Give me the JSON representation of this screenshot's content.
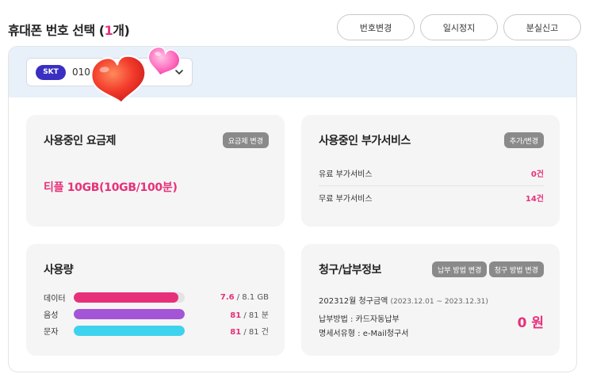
{
  "header": {
    "title_prefix": "휴대폰 번호 선택 (",
    "title_count": "1",
    "title_suffix": "개)",
    "buttons": [
      "번호변경",
      "일시정지",
      "분실신고"
    ]
  },
  "phone_select": {
    "carrier": "SKT",
    "number": "010-"
  },
  "plan_card": {
    "title": "사용중인 요금제",
    "button": "요금제 변경",
    "plan_name": "티플 10GB(10GB/100분)"
  },
  "addon_card": {
    "title": "사용중인 부가서비스",
    "button": "추가/변경",
    "rows": [
      {
        "label": "유료 부가서비스",
        "value": "0건"
      },
      {
        "label": "무료 부가서비스",
        "value": "14건"
      }
    ]
  },
  "usage_card": {
    "title": "사용량",
    "rows": [
      {
        "label": "데이터",
        "used": "7.6",
        "rest": " / 8.1 GB",
        "fraction": 0.94,
        "color": "#e6317a"
      },
      {
        "label": "음성",
        "used": "81",
        "rest": " / 81 분",
        "fraction": 1.0,
        "color": "#a455d6"
      },
      {
        "label": "문자",
        "used": "81",
        "rest": " / 81 건",
        "fraction": 1.0,
        "color": "#3dd3ee"
      }
    ]
  },
  "billing_card": {
    "title": "청구/납부정보",
    "buttons": [
      "납부 방법 변경",
      "청구 방법 변경"
    ],
    "month_label": "202312월 청구금액",
    "period": "(2023.12.01 ~ 2023.12.31)",
    "pay_method": "납부방법 : 카드자동납부",
    "statement_type": "명세서유형 : e-Mail청구서",
    "amount": "0 원"
  },
  "colors": {
    "accent": "#e6317a",
    "carrier_badge": "#3b2fc2",
    "panel_top": "#e8f0fa"
  },
  "icons": [
    "chevron-down-icon",
    "heart-icon"
  ]
}
